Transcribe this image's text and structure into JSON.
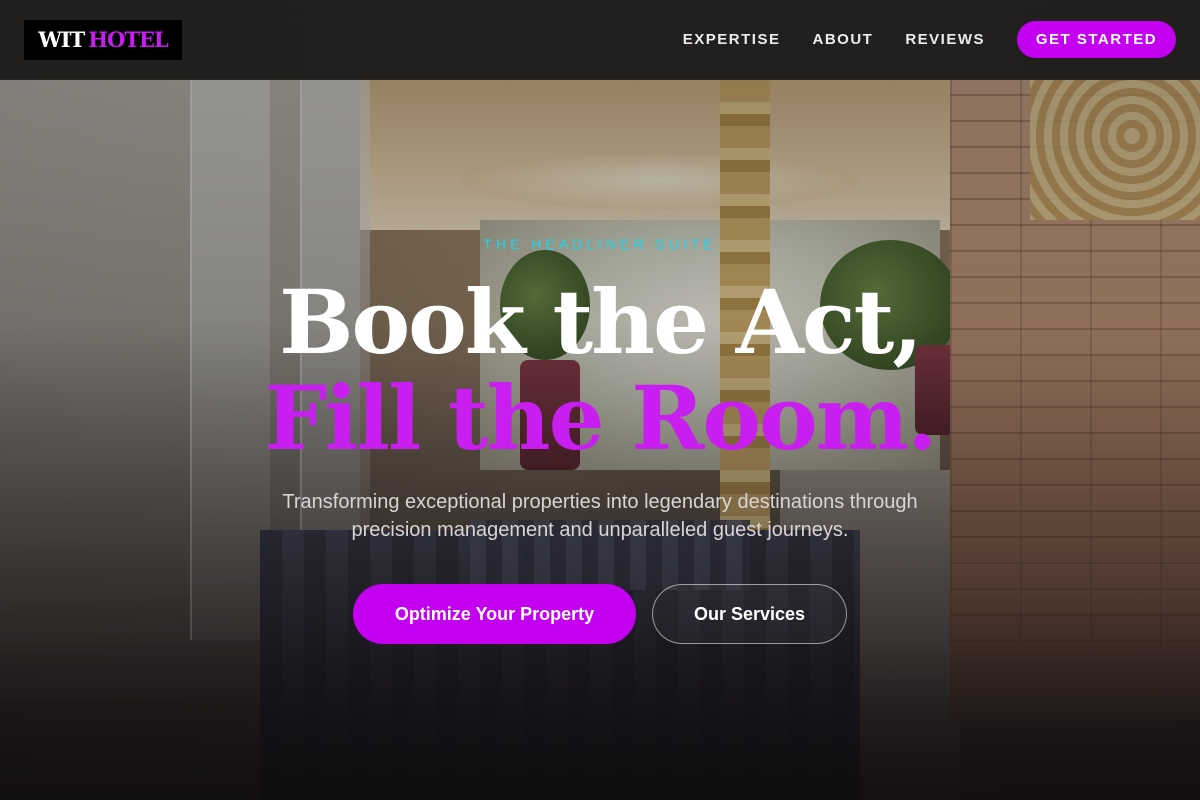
{
  "header": {
    "logo": {
      "part1": "WIT",
      "part2": "HOTEL"
    },
    "nav": [
      {
        "label": "EXPERTISE"
      },
      {
        "label": "ABOUT"
      },
      {
        "label": "REVIEWS"
      }
    ],
    "cta_label": "GET STARTED"
  },
  "hero": {
    "eyebrow": "THE HEADLINER SUITE",
    "title_line1": "Book the Act,",
    "title_line2": "Fill the Room.",
    "subtitle": "Transforming exceptional properties into legendary destinations through precision management and unparalleled guest journeys.",
    "primary_button": "Optimize Your Property",
    "secondary_button": "Our Services"
  },
  "colors": {
    "accent": "#c300f0",
    "eyebrow": "#19d6ea",
    "header_bg": "#1c1c1c"
  }
}
